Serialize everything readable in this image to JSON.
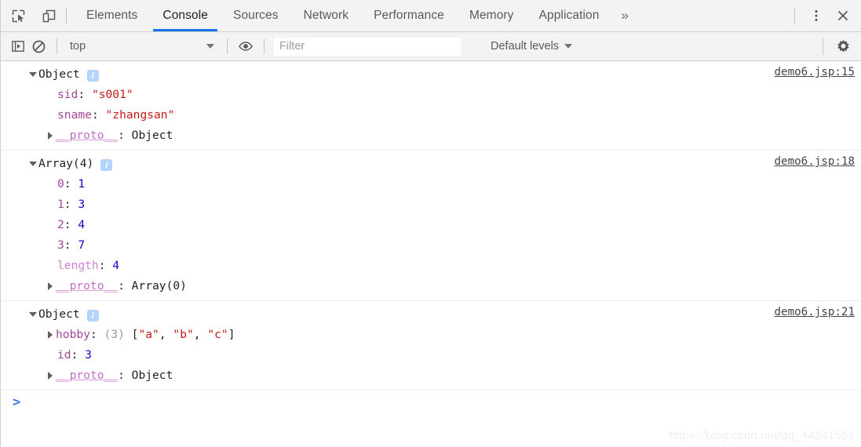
{
  "tabbar": {
    "icons": [
      {
        "name": "inspect-element-icon",
        "label": "Inspect element"
      },
      {
        "name": "device-toolbar-icon",
        "label": "Toggle device toolbar"
      }
    ],
    "tabs": [
      {
        "label": "Elements",
        "active": false
      },
      {
        "label": "Console",
        "active": true
      },
      {
        "label": "Sources",
        "active": false
      },
      {
        "label": "Network",
        "active": false
      },
      {
        "label": "Performance",
        "active": false
      },
      {
        "label": "Memory",
        "active": false
      },
      {
        "label": "Application",
        "active": false
      }
    ],
    "more_label": "»",
    "menu_icon": "more-vertical-icon",
    "close_icon": "close-icon"
  },
  "filterbar": {
    "sidebar_toggle_icon": "console-sidebar-icon",
    "clear_icon": "clear-console-icon",
    "context": "top",
    "eye_icon": "live-expression-icon",
    "filter_placeholder": "Filter",
    "filter_value": "",
    "levels_label": "Default levels",
    "settings_icon": "gear-icon"
  },
  "colors": {
    "accent": "#1a73e8",
    "string": "#c41a16",
    "number": "#1c00cf",
    "key": "#a0499a",
    "proto": "#c46fc4",
    "toolbar_bg": "#f3f3f3",
    "badge_bg": "#b3d4fc"
  },
  "console": {
    "messages": [
      {
        "header": "Object",
        "source": "demo6.jsp:15",
        "badge": "i",
        "props": [
          {
            "key": "sid",
            "sep": ": ",
            "value": "\"s001\"",
            "vtype": "string",
            "expandable": false
          },
          {
            "key": "sname",
            "sep": ": ",
            "value": "\"zhangsan\"",
            "vtype": "string",
            "expandable": false
          }
        ],
        "proto": {
          "key": "__proto__",
          "sep": ": ",
          "value": "Object"
        }
      },
      {
        "header": "Array(4)",
        "source": "demo6.jsp:18",
        "badge": "i",
        "props": [
          {
            "key": "0",
            "sep": ": ",
            "value": "1",
            "vtype": "number",
            "expandable": false
          },
          {
            "key": "1",
            "sep": ": ",
            "value": "3",
            "vtype": "number",
            "expandable": false
          },
          {
            "key": "2",
            "sep": ": ",
            "value": "4",
            "vtype": "number",
            "expandable": false
          },
          {
            "key": "3",
            "sep": ": ",
            "value": "7",
            "vtype": "number",
            "expandable": false
          },
          {
            "key": "length",
            "sep": ": ",
            "value": "4",
            "vtype": "number",
            "expandable": false,
            "dimkey": true
          }
        ],
        "proto": {
          "key": "__proto__",
          "sep": ": ",
          "value": "Array(0)"
        }
      },
      {
        "header": "Object",
        "source": "demo6.jsp:21",
        "badge": "i",
        "props": [
          {
            "key": "hobby",
            "sep": ": ",
            "count": "(3) ",
            "array_open": "[",
            "array_items": [
              "\"a\"",
              "\"b\"",
              "\"c\""
            ],
            "array_sep": ", ",
            "array_close": "]",
            "vtype": "array",
            "expandable": true
          },
          {
            "key": "id",
            "sep": ": ",
            "value": "3",
            "vtype": "number",
            "expandable": false
          }
        ],
        "proto": {
          "key": "__proto__",
          "sep": ": ",
          "value": "Object"
        }
      }
    ],
    "prompt_symbol": ">",
    "prompt_value": ""
  },
  "watermark": "https://blog.csdn.net/qq_44241551"
}
